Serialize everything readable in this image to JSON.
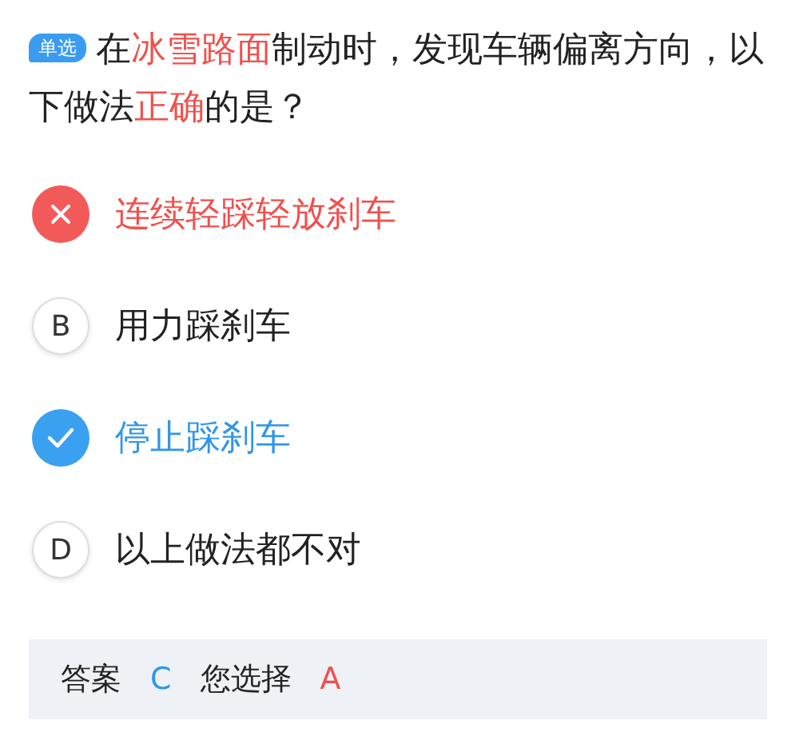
{
  "question": {
    "badge": "单选",
    "segments": [
      {
        "text": "在",
        "highlight": false
      },
      {
        "text": "冰雪路面",
        "highlight": true
      },
      {
        "text": "制动时，发现车辆偏离方向，以下做法",
        "highlight": false
      },
      {
        "text": "正确",
        "highlight": true
      },
      {
        "text": "的是？",
        "highlight": false
      }
    ]
  },
  "options": [
    {
      "kind": "wrong",
      "text": "连续轻踩轻放刹车"
    },
    {
      "kind": "normal",
      "letter": "B",
      "text": "用力踩刹车"
    },
    {
      "kind": "correct",
      "text": "停止踩刹车"
    },
    {
      "kind": "normal",
      "letter": "D",
      "text": "以上做法都不对"
    }
  ],
  "answer_bar": {
    "answer_label": "答案",
    "answer": "C",
    "choice_label": "您选择",
    "choice": "A"
  }
}
